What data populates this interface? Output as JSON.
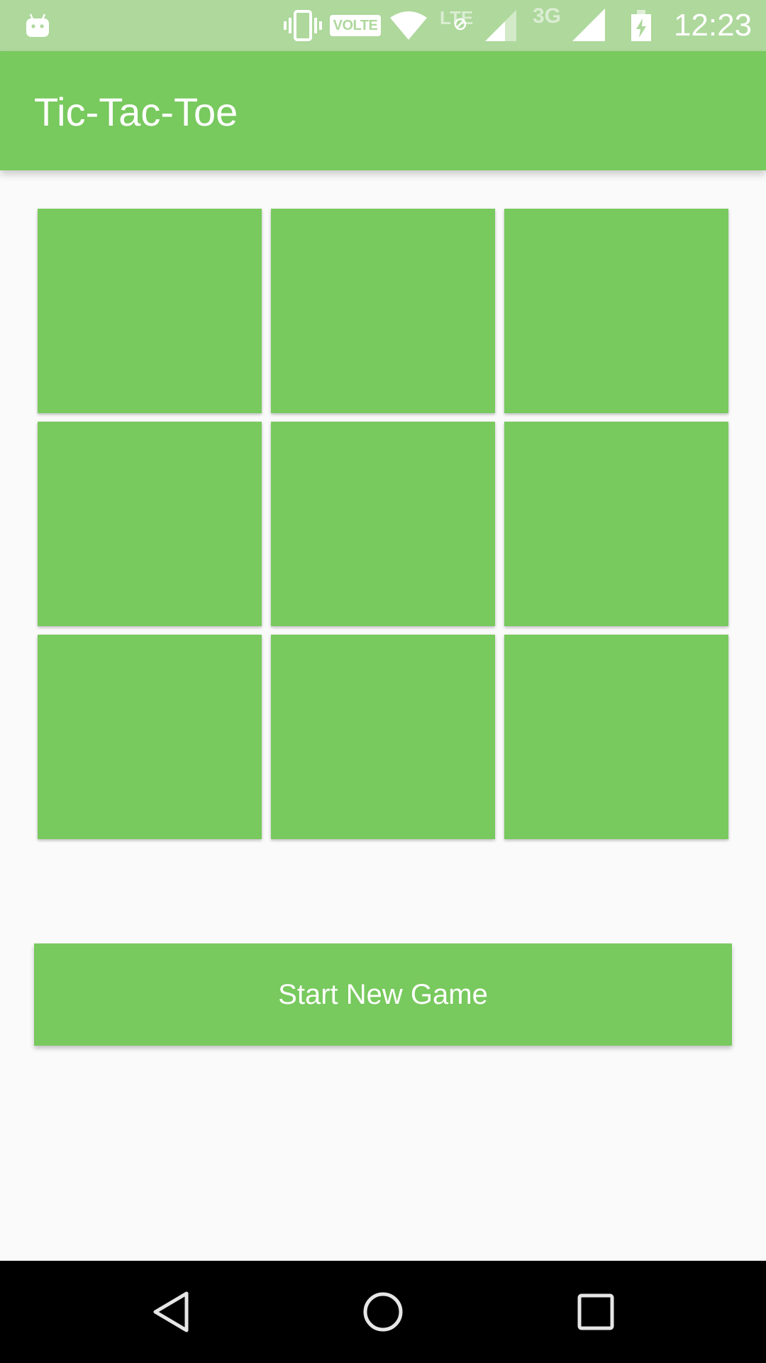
{
  "status_bar": {
    "network_badge": "VOLTE",
    "lte_label": "LTE",
    "threeg_label": "3G",
    "time": "12:23",
    "icons": [
      "android-icon",
      "vibrate-icon",
      "wifi-icon",
      "lte-signal-icon",
      "3g-signal-icon",
      "battery-charging-icon"
    ]
  },
  "app_bar": {
    "title": "Tic-Tac-Toe"
  },
  "board": {
    "cells": [
      "",
      "",
      "",
      "",
      "",
      "",
      "",
      "",
      ""
    ]
  },
  "actions": {
    "start_new_game": "Start New Game"
  },
  "nav_bar": {
    "icons": [
      "back-icon",
      "home-icon",
      "recents-icon"
    ]
  },
  "colors": {
    "status_bar": "#aed89c",
    "primary": "#78c95e",
    "background": "#fafafa",
    "nav_bar": "#000000"
  }
}
